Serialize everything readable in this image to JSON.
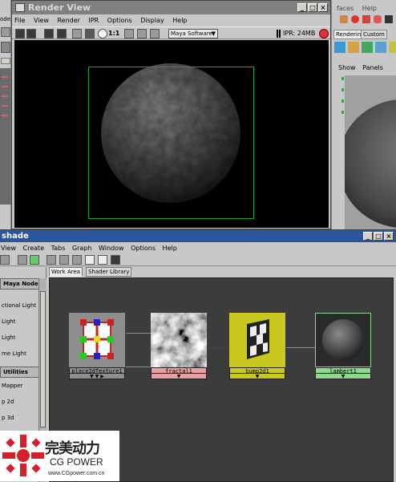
{
  "background_window": {
    "left_strip_labels": [
      "ode"
    ],
    "right_menu": [
      "faces",
      "Help"
    ],
    "shelf_tabs": [
      "Rendering",
      "Custom"
    ],
    "panel_menu": [
      "Show",
      "Panels"
    ]
  },
  "render_view": {
    "title": "Render View",
    "menu": [
      "File",
      "View",
      "Render",
      "IPR",
      "Options",
      "Display",
      "Help"
    ],
    "zoom_label": "1:1",
    "renderer": "Maya Software",
    "ipr_status": "IPR: 24MB"
  },
  "hypershade": {
    "title": "shade",
    "menu": [
      "View",
      "Create",
      "Tabs",
      "Graph",
      "Window",
      "Options",
      "Help"
    ],
    "left_panel": {
      "header_maya_nodes": "Maya Nodes",
      "light_items": [
        "ctional Light",
        "Light",
        "Light",
        "me Light"
      ],
      "header_utilities": "Utilities",
      "utility_items": [
        "Mapper",
        "p 2d",
        "p 3d"
      ]
    },
    "tabs": [
      "Work Area",
      "Shader Library"
    ],
    "nodes": [
      {
        "name": "place2dTexture1",
        "type": "place2d"
      },
      {
        "name": "fractal1",
        "type": "fractal"
      },
      {
        "name": "bump2d1",
        "type": "bump"
      },
      {
        "name": "lambert1",
        "type": "lambert"
      }
    ],
    "node_colors": {
      "place2d": "#8e8e8e",
      "fractal": "#e8a0a0",
      "bump": "#c8c820",
      "lambert": "#8ed88e"
    }
  },
  "logo": {
    "chinese": "完美动力",
    "english": "CG POWER",
    "url": "www.CGpower.com.cn"
  }
}
